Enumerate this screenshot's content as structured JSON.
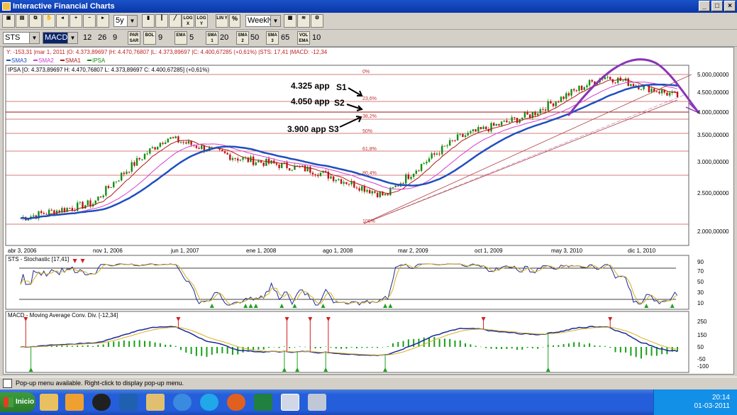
{
  "window": {
    "title": "Interactive Financial Charts"
  },
  "toolbar1": {
    "period_value": "5y",
    "scale_buttons": [
      "LOG X",
      "LOG Y",
      "LIN Y",
      "%"
    ],
    "interval_value": "Weekly"
  },
  "toolbar2": {
    "symbol_value": "STS",
    "indicator_value": "MACD",
    "params": [
      "12",
      "26",
      "9"
    ],
    "par_sar_label": "PAR SAR",
    "bol_label": "BOL",
    "bol_value": "9",
    "ema_label": "EMA",
    "ema_value": "5",
    "sma1_label": "SMA 1",
    "sma1_value": "20",
    "sma2_label": "SMA 2",
    "sma2_value": "50",
    "sma3_label": "SMA 3",
    "sma3_value": "65",
    "vol_label": "VOL EMA",
    "vol_value": "10"
  },
  "main_panel": {
    "info_line": "Y: -153,31 |mar 1, 2011 |O: 4.373,89697 |H: 4.470,76807 |L: 4.373,89697 |C: 4.400,67285 (+0,61%) |STS: 17,41 |MACD: -12,34",
    "legend": [
      {
        "label": "SMA3",
        "color": "#1f4fbf"
      },
      {
        "label": "SMA2",
        "color": "#d23ed2"
      },
      {
        "label": "SMA1",
        "color": "#b01818"
      },
      {
        "label": "IPSA",
        "color": "#108a10"
      }
    ],
    "ipsa_label": "IPSA [O: 4.373,89697  H: 4.470,76807  L: 4.373,89697  C: 4.400,67285] (+0,61%)",
    "y_axis": [
      "5.000,00000",
      "4.500,00000",
      "4.000,00000",
      "3.500,00000",
      "3.000,00000",
      "2.500,00000",
      "2.000,00000"
    ],
    "x_axis": [
      "abr 3, 2006",
      "nov 1, 2006",
      "jun 1, 2007",
      "ene 1, 2008",
      "ago 1, 2008",
      "mar 2, 2009",
      "oct 1, 2009",
      "may 3, 2010",
      "dic 1, 2010"
    ],
    "fib_levels": [
      "0%",
      "23,6%",
      "38,2%",
      "50%",
      "61,8%",
      "80,4%",
      "100%"
    ],
    "annotations": [
      {
        "value": "4.325 app",
        "tag": "S1"
      },
      {
        "value": "4.050 app",
        "tag": "S2"
      },
      {
        "value": "3.900 app",
        "tag": "S3"
      }
    ]
  },
  "stochastic_panel": {
    "title": "STS - Stochastic [17,41]",
    "y_axis": [
      "90",
      "70",
      "50",
      "30",
      "10"
    ]
  },
  "macd_panel": {
    "title": "MACD - Moving Average Conv. Div. [-12,34]",
    "y_axis": [
      "250",
      "150",
      "50",
      "-50",
      "-100"
    ]
  },
  "statusbar": {
    "text": "Pop-up menu available. Right-click to display pop-up menu."
  },
  "taskbar": {
    "start_label": "Inicio",
    "clock_time": "20:14",
    "clock_date": "01-03-2011"
  },
  "chart_data": {
    "type": "line",
    "title": "IPSA",
    "series": [
      {
        "name": "IPSA",
        "x": [
          "abr 3, 2006",
          "nov 1, 2006",
          "jun 1, 2007",
          "ene 1, 2008",
          "ago 1, 2008",
          "mar 2, 2009",
          "oct 1, 2009",
          "may 3, 2010",
          "dic 1, 2010",
          "mar 1, 2011"
        ],
        "values": [
          2150,
          2350,
          3450,
          3050,
          2850,
          2450,
          3450,
          3950,
          4950,
          4400
        ]
      }
    ],
    "ylim": [
      1950,
      5150
    ],
    "fib_levels": {
      "0%": 5000,
      "23,6%": 4325,
      "38,2%": 3900,
      "50%": 3550,
      "61,8%": 3200,
      "80,4%": 2750,
      "100%": 2100
    }
  }
}
